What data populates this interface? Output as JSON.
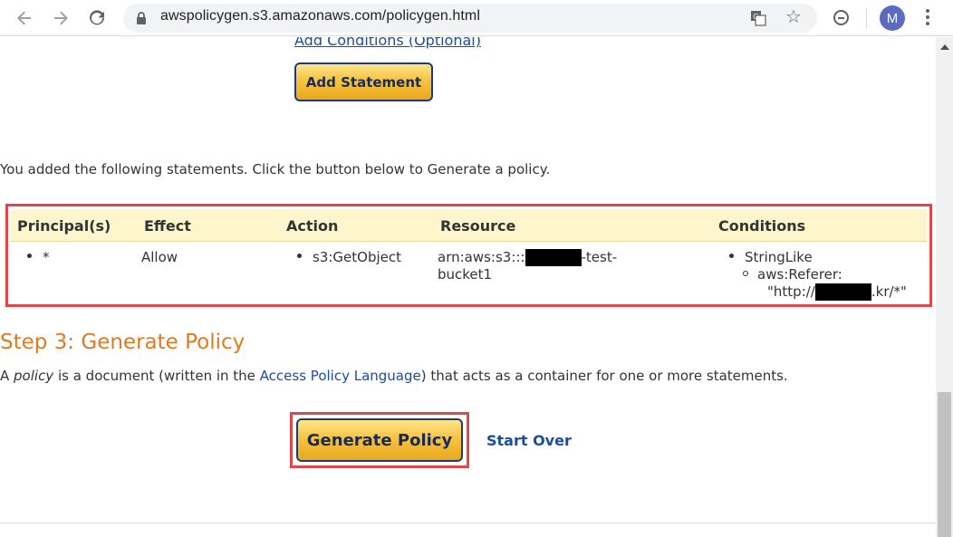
{
  "browser": {
    "url": "awspolicygen.s3.amazonaws.com/policygen.html",
    "avatar_letter": "M",
    "icons": [
      "back-arrow-icon",
      "forward-arrow-icon",
      "reload-icon",
      "lock-icon",
      "translate-icon",
      "star-icon",
      "minus-circle-icon",
      "kebab-menu-icon"
    ]
  },
  "page": {
    "add_conditions_link": "Add Conditions (Optional)",
    "add_statement_label": "Add Statement",
    "intro_text": "You added the following statements. Click the button below to Generate a policy.",
    "table": {
      "headers": {
        "principals": "Principal(s)",
        "effect": "Effect",
        "action": "Action",
        "resource": "Resource",
        "conditions": "Conditions"
      },
      "row": {
        "principal": "*",
        "effect": "Allow",
        "action": "s3:GetObject",
        "resource_prefix": "arn:aws:s3:::",
        "resource_suffix": "-test-",
        "resource_line2": "bucket1",
        "condition_operator": "StringLike",
        "condition_key": "aws:Referer:",
        "condition_value_prefix": "\"http://",
        "condition_value_suffix": ".kr/*\""
      }
    },
    "step3": {
      "title": "Step 3: Generate Policy",
      "desc_a": "A ",
      "desc_policy": "policy",
      "desc_b": " is a document (written in the ",
      "desc_link": "Access Policy Language",
      "desc_c": ") that acts as a container for one or more statements."
    },
    "generate_policy_label": "Generate Policy",
    "start_over_label": "Start Over"
  },
  "colors": {
    "accent_orange": "#e07b21",
    "link_blue": "#1a4e9c",
    "highlight_red": "#e0474c",
    "button_gold": "#f6c342",
    "table_header_bg": "#fdf5cc"
  }
}
